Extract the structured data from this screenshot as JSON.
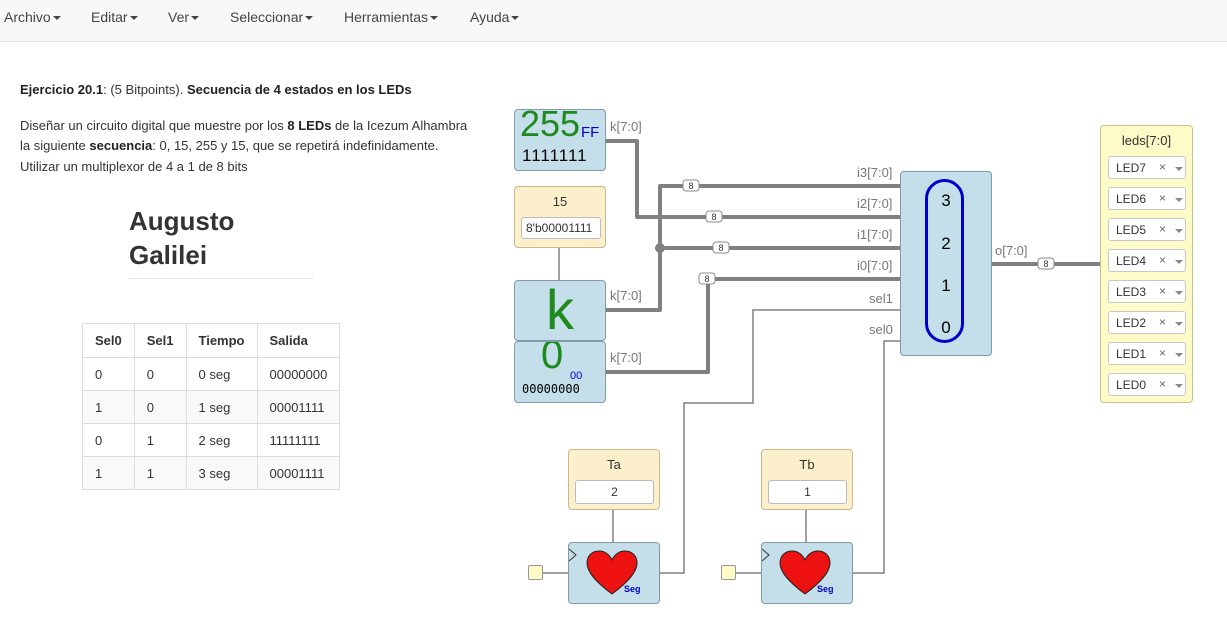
{
  "menu": [
    {
      "label": "Archivo"
    },
    {
      "label": "Editar"
    },
    {
      "label": "Ver"
    },
    {
      "label": "Seleccionar"
    },
    {
      "label": "Herramientas"
    },
    {
      "label": "Ayuda"
    }
  ],
  "exercise": {
    "id": "Ejercicio 20.1",
    "points": ": (5 Bitpoints). ",
    "title": "Secuencia de 4 estados en los LEDs",
    "line1_a": "Diseñar un circuito digital que muestre por los ",
    "line1_b": "8 LEDs",
    "line1_c": " de la Icezum Alhambra",
    "line2_a": "la siguiente ",
    "line2_b": "secuencia",
    "line2_c": ": 0, 15, 255 y 15, que se repetirá indefinidamente.",
    "line3": "Utilizar un multiplexor de 4 a 1 de 8 bits"
  },
  "author": {
    "first": "Augusto",
    "last": "Galilei"
  },
  "table": {
    "headers": [
      "Sel0",
      "Sel1",
      "Tiempo",
      "Salida"
    ],
    "rows": [
      [
        "0",
        "0",
        "0 seg",
        "00000000"
      ],
      [
        "1",
        "0",
        "1 seg",
        "00001111"
      ],
      [
        "0",
        "1",
        "2 seg",
        "11111111"
      ],
      [
        "1",
        "1",
        "3 seg",
        "00001111"
      ]
    ]
  },
  "circuit": {
    "const255": {
      "dec": "255",
      "hex": "FF",
      "bin": "1111111",
      "port": "k[7:0]"
    },
    "param15": {
      "label": "15",
      "value": "8'b00001111"
    },
    "constK": {
      "glyph": "k",
      "port": "k[7:0]"
    },
    "const0": {
      "dec": "0",
      "hex": "00",
      "bin": "00000000",
      "port": "k[7:0]"
    },
    "mux": {
      "inputs": [
        "i3[7:0]",
        "i2[7:0]",
        "i1[7:0]",
        "i0[7:0]",
        "sel1",
        "sel0"
      ],
      "output": "o[7:0]",
      "channels": [
        "3",
        "2",
        "1",
        "0"
      ]
    },
    "bus_width": "8",
    "leds": {
      "title": "leds[7:0]",
      "items": [
        "LED7",
        "LED6",
        "LED5",
        "LED4",
        "LED3",
        "LED2",
        "LED1",
        "LED0"
      ],
      "remove_glyph": "×"
    },
    "timer_a": {
      "label": "Ta",
      "value": "2",
      "unit": "Seg"
    },
    "timer_b": {
      "label": "Tb",
      "value": "1",
      "unit": "Seg"
    }
  },
  "colors": {
    "wire": "#808080",
    "block_blue": "#c4dfea",
    "mux_ring": "#0000cc",
    "const_green": "#1e8a1e",
    "heart": "#ee1111"
  }
}
